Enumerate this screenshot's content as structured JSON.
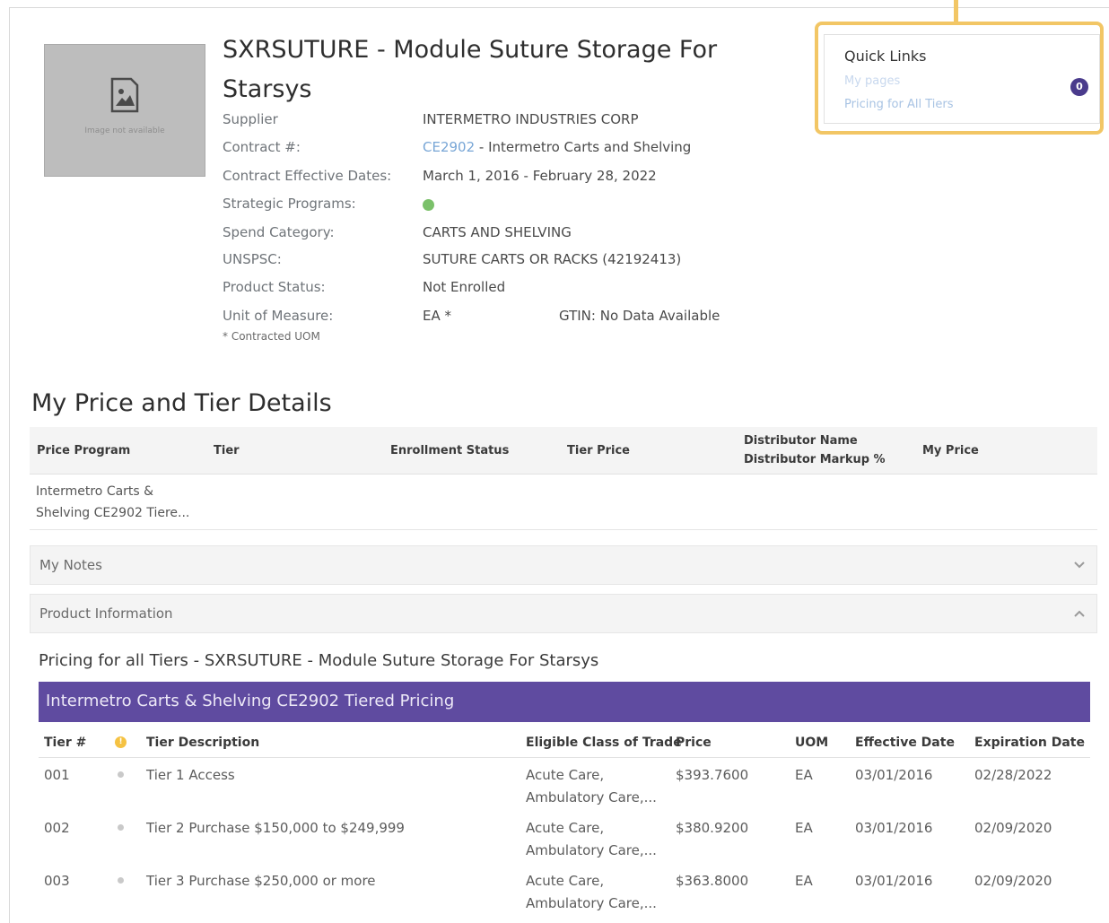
{
  "product": {
    "title": "SXRSUTURE - Module Suture Storage For Starsys",
    "image_caption": "Image not available"
  },
  "info": [
    {
      "label": "Supplier",
      "value": "INTERMETRO INDUSTRIES CORP"
    },
    {
      "label": "Contract #:",
      "link": "CE2902",
      "value": " - Intermetro Carts and Shelving"
    },
    {
      "label": "Contract Effective Dates:",
      "value": "March 1, 2016 - February 28, 2022"
    },
    {
      "label": "Strategic Programs:",
      "value": ""
    },
    {
      "label": "Spend Category:",
      "value": "CARTS AND SHELVING"
    },
    {
      "label": "UNSPSC:",
      "value": "SUTURE CARTS OR RACKS (42192413)"
    },
    {
      "label": "Product Status:",
      "value": "Not Enrolled"
    },
    {
      "label": "Unit of Measure:",
      "value": "EA *",
      "gtin": "GTIN: No Data Available"
    }
  ],
  "contracted_uom_note": "* Contracted UOM",
  "quick_links": {
    "title": "Quick Links",
    "items": [
      "My pages",
      "Pricing for All Tiers"
    ],
    "badge": "0"
  },
  "price_tier": {
    "title": "My Price and Tier Details",
    "headers": [
      "Price Program",
      "Tier",
      "Enrollment Status",
      "Tier Price",
      "Distributor Name",
      "Distributor Markup %",
      "My Price"
    ],
    "program": [
      "Intermetro Carts &",
      "Shelving CE2902 Tiere..."
    ]
  },
  "accordions": {
    "notes": "My Notes",
    "product_info": "Product Information"
  },
  "pricing": {
    "title": "Pricing for all Tiers - SXRSUTURE - Module Suture Storage For Starsys",
    "bar_label": "Intermetro Carts & Shelving CE2902 Tiered Pricing",
    "headers": [
      "Tier #",
      "Tier Description",
      "Eligible Class of Trade",
      "Price",
      "UOM",
      "Effective Date",
      "Expiration Date"
    ],
    "warn_icon": "!",
    "rows": [
      {
        "tier": "001",
        "desc": "Tier 1 Access",
        "cot1": "Acute Care,",
        "cot2": "Ambulatory Care,...",
        "price": "$393.7600",
        "uom": "EA",
        "eff": "03/01/2016",
        "exp": "02/28/2022"
      },
      {
        "tier": "002",
        "desc": "Tier 2 Purchase $150,000 to $249,999",
        "cot1": "Acute Care,",
        "cot2": "Ambulatory Care,...",
        "price": "$380.9200",
        "uom": "EA",
        "eff": "03/01/2016",
        "exp": "02/09/2020"
      },
      {
        "tier": "003",
        "desc": "Tier 3 Purchase $250,000 or more",
        "cot1": "Acute Care,",
        "cot2": "Ambulatory Care,...",
        "price": "$363.8000",
        "uom": "EA",
        "eff": "03/01/2016",
        "exp": "02/09/2020"
      }
    ]
  },
  "colors": {
    "purple": "#5f4ba0",
    "highlight": "#f2c665",
    "link": "#78a6d6",
    "green": "#7bc16a"
  }
}
